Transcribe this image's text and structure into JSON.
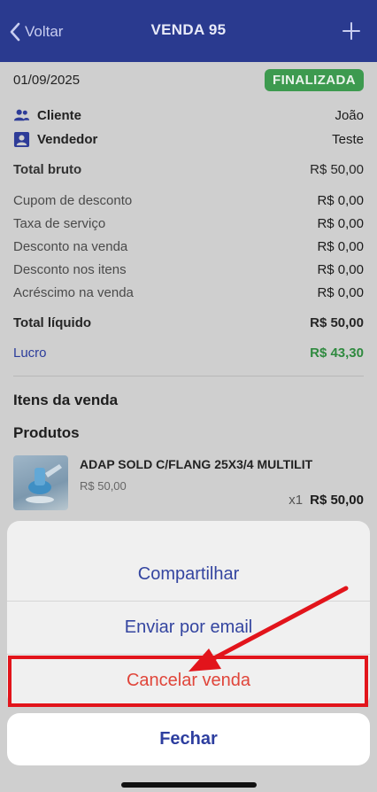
{
  "nav": {
    "back_label": "Voltar",
    "title": "VENDA 95"
  },
  "sale": {
    "date": "01/09/2025",
    "status": "FINALIZADA",
    "cliente_label": "Cliente",
    "cliente_value": "João",
    "vendedor_label": "Vendedor",
    "vendedor_value": "Teste",
    "total_bruto_label": "Total bruto",
    "total_bruto_value": "R$ 50,00",
    "cupom_label": "Cupom de desconto",
    "cupom_value": "R$ 0,00",
    "taxa_label": "Taxa de serviço",
    "taxa_value": "R$ 0,00",
    "desconto_venda_label": "Desconto na venda",
    "desconto_venda_value": "R$ 0,00",
    "desconto_itens_label": "Desconto nos itens",
    "desconto_itens_value": "R$ 0,00",
    "acrescimo_label": "Acréscimo na venda",
    "acrescimo_value": "R$ 0,00",
    "total_liquido_label": "Total líquido",
    "total_liquido_value": "R$ 50,00",
    "lucro_label": "Lucro",
    "lucro_value": "R$ 43,30"
  },
  "items": {
    "section_title": "Itens da venda",
    "products_title": "Produtos",
    "products": [
      {
        "name": "ADAP SOLD C/FLANG 25X3/4 MULTILIT",
        "unit_price": "R$ 50,00",
        "qty": "x1",
        "total": "R$ 50,00"
      }
    ]
  },
  "action_sheet": {
    "share": "Compartilhar",
    "email": "Enviar por email",
    "cancel_sale": "Cancelar venda",
    "close": "Fechar"
  },
  "colors": {
    "nav_bg": "#2a3a8f",
    "status_green": "#3d9a4f",
    "action_blue": "#3445a0",
    "destructive_red": "#e0453a",
    "annotation_red": "#e2141b"
  },
  "icons": [
    "chevron-left-icon",
    "plus-icon",
    "people-icon",
    "person-badge-icon"
  ]
}
